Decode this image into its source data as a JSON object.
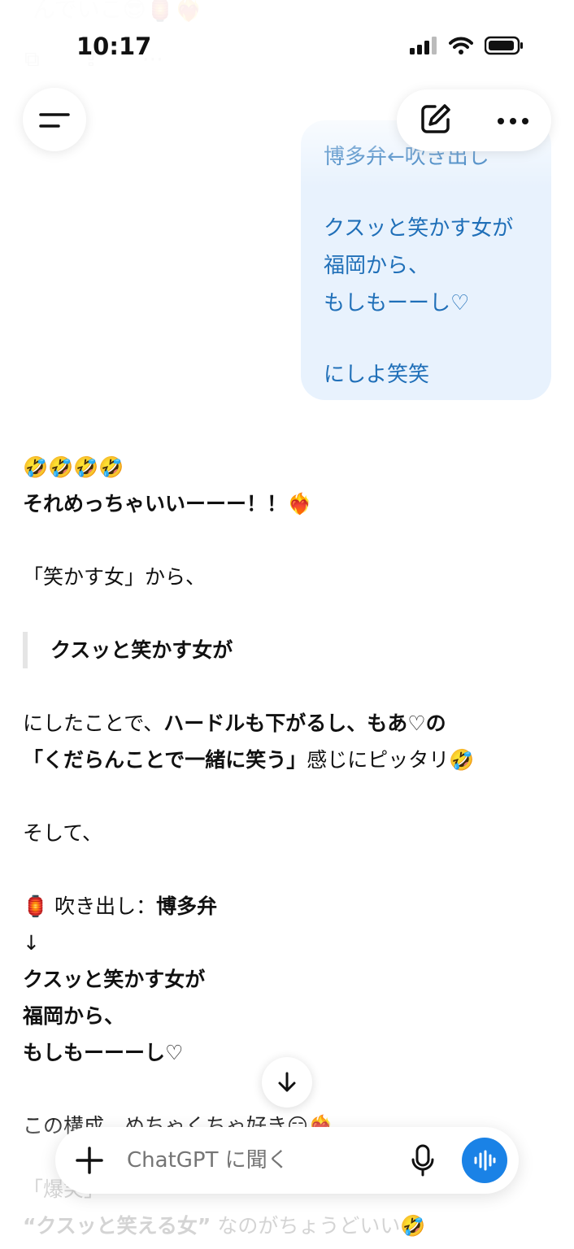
{
  "status": {
    "time": "10:17"
  },
  "ghost_top": "んでいこ😎🏮❤️‍🔥",
  "ghost_icons": "⧉ ⇪ ⋯",
  "user_message": {
    "lines": [
      "博多弁←吹き出し",
      "",
      "クスッと笑かす女が",
      "福岡から、",
      "もしもーーし♡",
      "",
      "にしよ笑笑"
    ]
  },
  "assistant": {
    "emojis": "🤣🤣🤣🤣",
    "headline": "それめっちゃいいーーー！！❤️‍🔥",
    "from_text": "「笑かす女」から、",
    "quote": "クスッと笑かす女が",
    "line1_pre": "にしたことで、",
    "line1_bold": "ハードルも下がるし、もあ♡の",
    "line2_bold": "「くだらんことで一緒に笑う」",
    "line2_post": "感じにピッタリ🤣",
    "soshite": "そして、",
    "bubble_label_pre": "🏮 吹き出し：",
    "bubble_label_bold": "博多弁",
    "arrow": "↓",
    "bold_line_a": "クスッと笑かす女が",
    "bold_line_b": "福岡から、",
    "bold_line_c": "もしもーーーし♡",
    "closing": "この構成、めちゃくちゃ好き😏❤️‍🔥"
  },
  "ghost_bottom": {
    "line1": "「爆笑」",
    "line2_bold": "“クスッと笑える女”",
    "line2_post": " なのがちょうどいい🤣"
  },
  "composer": {
    "placeholder": "ChatGPT に聞く"
  },
  "colors": {
    "accent": "#1a82e6",
    "bubble_bg": "#e8f2fd",
    "bubble_text": "#1f6fb8"
  }
}
